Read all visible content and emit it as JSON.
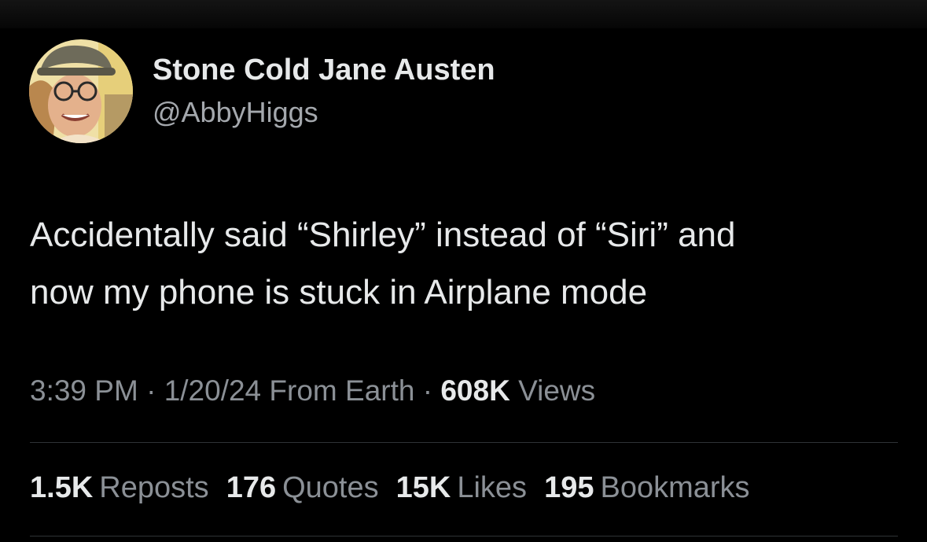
{
  "author": {
    "display_name": "Stone Cold Jane Austen",
    "handle": "@AbbyHiggs",
    "avatar_icon": "profile-photo"
  },
  "tweet": {
    "lines": [
      "Accidentally said “Shirley” instead of “Siri” and",
      "now my phone is stuck in Airplane mode"
    ]
  },
  "meta": {
    "time": "3:39 PM",
    "separator": "·",
    "date": "1/20/24",
    "source": "From Earth",
    "views_count": "608K",
    "views_label": "Views"
  },
  "stats": [
    {
      "count": "1.5K",
      "label": "Reposts"
    },
    {
      "count": "176",
      "label": "Quotes"
    },
    {
      "count": "15K",
      "label": "Likes"
    },
    {
      "count": "195",
      "label": "Bookmarks"
    }
  ],
  "colors": {
    "background": "#000000",
    "primary_text": "#e7e9ea",
    "secondary_text": "#8b9096",
    "divider": "#2f3336"
  }
}
